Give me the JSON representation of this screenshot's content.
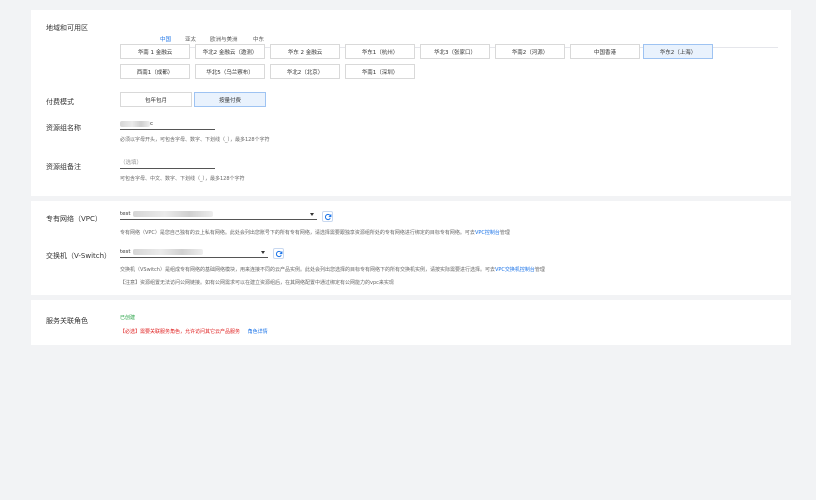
{
  "section_region": {
    "label": "地域和可用区",
    "tabs": [
      "中国",
      "亚太",
      "欧洲与美洲",
      "中东"
    ],
    "zones_row1": [
      "华南 1 金融云",
      "华北2 金融云（邀测）",
      "华东 2 金融云",
      "华东1（杭州）",
      "华北3（张家口）",
      "华南2（河源）",
      "中国香港",
      "华东2（上海）"
    ],
    "zones_row2": [
      "西南1（成都）",
      "华北5（乌兰察布）",
      "华北2（北京）",
      "华南1（深圳）"
    ]
  },
  "billing": {
    "label": "付费模式",
    "options": [
      "包年包月",
      "按量付费"
    ]
  },
  "rg_name": {
    "label": "资源组名称",
    "value": "c",
    "hint": "必须以字母开头，可包含字母、数字、下划线（_），最多128个字符"
  },
  "rg_note": {
    "label": "资源组备注",
    "placeholder": "（选填）",
    "hint": "可包含字母、中文、数字、下划线（_），最多128个字符"
  },
  "vpc": {
    "label": "专有网络（VPC）",
    "value": "test",
    "hint": "专有网络（VPC）是您自己独有的云上私有网络。此处会列出您账号下的所有专有网络，请选择需要跟独享资源组所处的专有网络进行绑定的目标专有网络。可去",
    "hint_link": "VPC控制台",
    "hint_tail": "管理"
  },
  "vswitch": {
    "label": "交换机（V-Switch）",
    "value": "test",
    "hint": "交换机（VSwitch）是组成专有网络的基础网络模块，用来连接不同的云产品实例。此处会列出您选择的目标专有网络下的所有交换机实例，请按实际需要进行选择。可去",
    "hint_link": "VPC交换机控制台",
    "hint_tail": "管理",
    "note": "【注意】资源组置无法访问公网链接。如有公网需求可以在建立资源组后，在其网络配置中通过绑定有公网能力的vpc来实现"
  },
  "service_role": {
    "label": "服务关联角色",
    "status": "已创建",
    "required": "【必选】需要关联服务角色，允许访问其它云产品服务",
    "link": "角色详情"
  },
  "colors": {
    "accent": "#1a73e8",
    "selected_bg": "#e9f2fd",
    "required_red": "#e02020",
    "created_green": "#1e9e3e"
  }
}
